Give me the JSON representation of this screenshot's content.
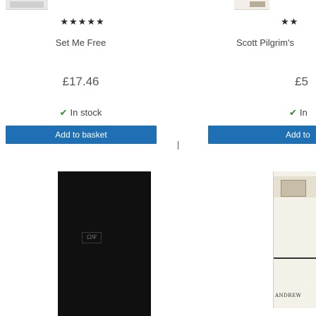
{
  "products": [
    {
      "rating_stars": "★★★★★",
      "rating": 5,
      "title": "Set Me Free",
      "price": "£17.46",
      "stock": "In stock",
      "add_label": "Add to basket",
      "cover_text": "ΩΨ"
    },
    {
      "rating_stars": "★★",
      "rating": 2,
      "title": "Scott Pilgrim's",
      "price": "£5",
      "stock": "In",
      "add_label": "Add to",
      "cover_author": "ANDREW"
    }
  ],
  "colors": {
    "button": "#1f6fb4",
    "check": "#2f8f2f"
  },
  "icons": {
    "stock": "check-icon",
    "rating": "star-icon"
  }
}
